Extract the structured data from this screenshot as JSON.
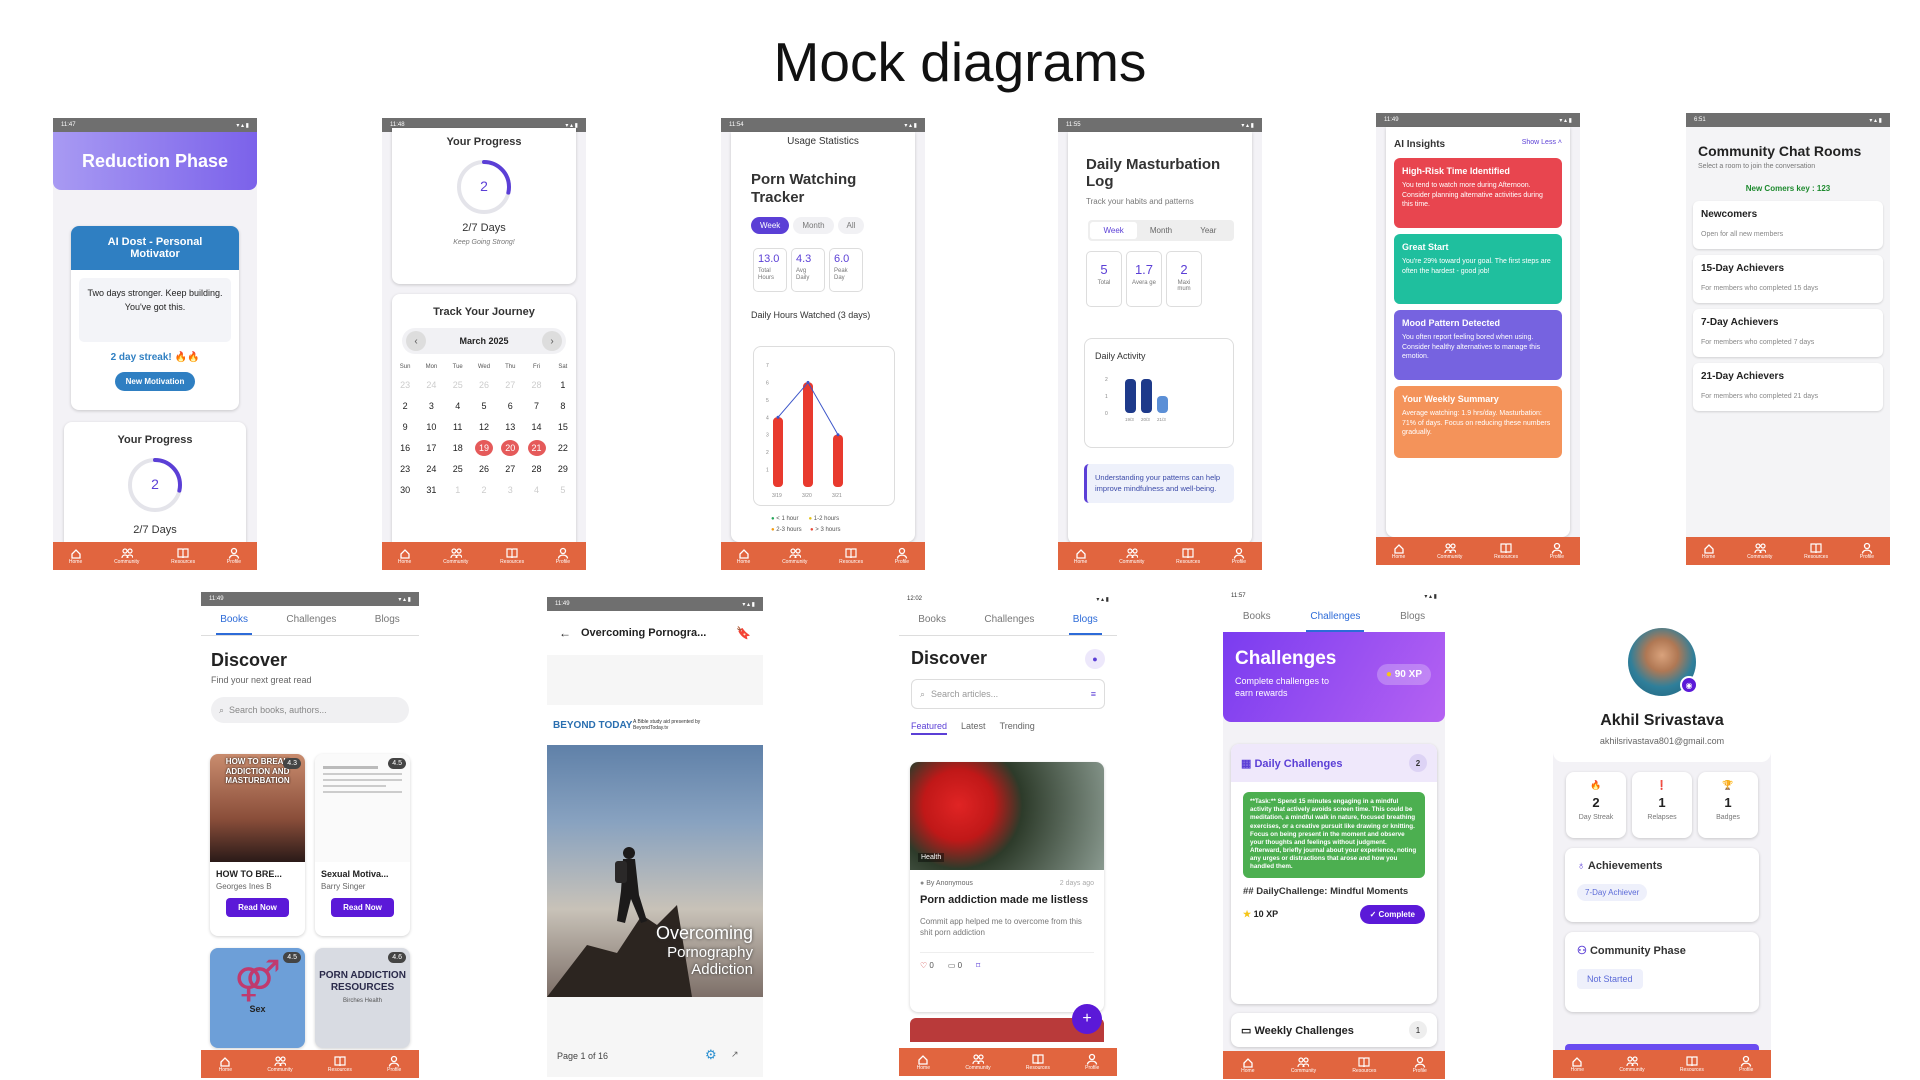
{
  "page_title": "Mock diagrams",
  "nav": {
    "home": "Home",
    "community": "Community",
    "resources": "Resources",
    "profile": "Profile"
  },
  "p1": {
    "time": "11:47",
    "header": "Reduction Phase",
    "motivator_title": "AI Dost - Personal Motivator",
    "message": "Two days stronger.  Keep building.  You've got this.",
    "streak": "2 day streak! 🔥🔥",
    "button": "New Motivation",
    "progress_title": "Your Progress",
    "progress_value": "2",
    "progress_days": "2/7 Days",
    "progress_fraction": 0.2857
  },
  "p2": {
    "time": "11:48",
    "progress_title": "Your Progress",
    "progress_value": "2",
    "progress_days": "2/7 Days",
    "progress_sub": "Keep Going Strong!",
    "progress_fraction": 0.2857,
    "journey_title": "Track Your Journey",
    "month": "March 2025",
    "weekdays": [
      "Sun",
      "Mon",
      "Tue",
      "Wed",
      "Thu",
      "Fri",
      "Sat"
    ],
    "weeks": [
      [
        "23",
        "24",
        "25",
        "26",
        "27",
        "28",
        "1"
      ],
      [
        "2",
        "3",
        "4",
        "5",
        "6",
        "7",
        "8"
      ],
      [
        "9",
        "10",
        "11",
        "12",
        "13",
        "14",
        "15"
      ],
      [
        "16",
        "17",
        "18",
        "19",
        "20",
        "21",
        "22"
      ],
      [
        "23",
        "24",
        "25",
        "26",
        "27",
        "28",
        "29"
      ],
      [
        "30",
        "31",
        "1",
        "2",
        "3",
        "4",
        "5"
      ]
    ]
  },
  "p3": {
    "time": "11:54",
    "header": "Usage Statistics",
    "title": "Porn Watching Tracker",
    "tabs": [
      "Week",
      "Month",
      "All"
    ],
    "stats": [
      {
        "value": "13.0",
        "label": "Total Hours"
      },
      {
        "value": "4.3",
        "label": "Avg Daily"
      },
      {
        "value": "6.0",
        "label": "Peak Day"
      }
    ],
    "chart_title": "Daily Hours Watched (3 days)",
    "legend": [
      "< 1 hour",
      "1-2 hours",
      "2-3 hours",
      "> 3 hours"
    ]
  },
  "p4": {
    "time": "11:55",
    "title": "Daily Masturbation Log",
    "subtitle": "Track your habits and patterns",
    "tabs": [
      "Week",
      "Month",
      "Year"
    ],
    "stats": [
      {
        "value": "5",
        "label": "Total"
      },
      {
        "value": "1.7",
        "label": "Avera ge"
      },
      {
        "value": "2",
        "label": "Maxi mum"
      }
    ],
    "activity_title": "Daily Activity",
    "note": "Understanding your patterns can help improve mindfulness and well-being."
  },
  "p5": {
    "time": "11:49",
    "title": "AI Insights",
    "toggle": "Show Less",
    "cards": [
      {
        "title": "High-Risk Time Identified",
        "text": "You tend to watch more during Afternoon. Consider planning alternative activities during this time.",
        "color": "#e8454f"
      },
      {
        "title": "Great Start",
        "text": "You're 29% toward your goal. The first steps are often the hardest - good job!",
        "color": "#1fbf9e"
      },
      {
        "title": "Mood Pattern Detected",
        "text": "You often report feeling bored when using. Consider healthy alternatives to manage this emotion.",
        "color": "#7663e0"
      },
      {
        "title": "Your Weekly Summary",
        "text": "Average watching: 1.9 hrs/day. Masturbation: 71% of days. Focus on reducing these numbers gradually.",
        "color": "#f4935a"
      }
    ]
  },
  "p6": {
    "time": "6:51",
    "title": "Community Chat Rooms",
    "subtitle": "Select a room to join the conversation",
    "key": "New Comers key : 123",
    "rooms": [
      {
        "name": "Newcomers",
        "desc": "Open for all new members"
      },
      {
        "name": "15-Day Achievers",
        "desc": "For members who completed 15 days"
      },
      {
        "name": "7-Day Achievers",
        "desc": "For members who completed 7 days"
      },
      {
        "name": "21-Day Achievers",
        "desc": "For members who completed 21 days"
      }
    ]
  },
  "p7": {
    "time": "11:49",
    "tabs": [
      "Books",
      "Challenges",
      "Blogs"
    ],
    "title": "Discover",
    "subtitle": "Find your next great read",
    "search_placeholder": "Search books, authors...",
    "books": [
      {
        "title": "HOW TO BRE...",
        "author": "Georges Ines B",
        "rating": "4.3",
        "cover_text": "HOW TO BREAK ADDICTION AND MASTURBATION",
        "button": "Read Now"
      },
      {
        "title": "Sexual Motiva...",
        "author": "Barry Singer",
        "rating": "4.5",
        "button": "Read Now"
      },
      {
        "rating": "4.5",
        "cover_text": "Sex"
      },
      {
        "rating": "4.6",
        "cover_text": "PORN ADDICTION RESOURCES",
        "cover_sub": "Birches Health"
      }
    ]
  },
  "p8": {
    "time": "11:49",
    "title": "Overcoming Pornogra...",
    "brand": "BEYOND TODAY",
    "brand_sub": "A Bible study aid presented by BeyondToday.tv",
    "cover_title": "Overcoming",
    "cover_sub1": "Pornography",
    "cover_sub2": "Addiction",
    "page": "Page 1 of 16"
  },
  "p9": {
    "time": "12:02",
    "tabs": [
      "Books",
      "Challenges",
      "Blogs"
    ],
    "title": "Discover",
    "search_placeholder": "Search articles...",
    "filters": [
      "Featured",
      "Latest",
      "Trending"
    ],
    "tag": "Health",
    "author": "By Anonymous",
    "ago": "2 days ago",
    "post_title": "Porn addiction made me listless",
    "post_text": "Commit app helped me to overcome from this shit porn addiction",
    "likes": "0",
    "comments": "0"
  },
  "p10": {
    "time": "11:57",
    "tabs": [
      "Books",
      "Challenges",
      "Blogs"
    ],
    "title": "Challenges",
    "subtitle": "Complete challenges to earn rewards",
    "xp": "90 XP",
    "daily": "Daily Challenges",
    "daily_count": "2",
    "task": "**Task:** Spend 15 minutes engaging in a mindful activity that actively avoids screen time. This could be meditation, a mindful walk in nature, focused breathing exercises, or a creative pursuit like drawing or knitting. Focus on being present in the moment and observe your thoughts and feelings without judgment. Afterward, briefly journal about your experience, noting any urges or distractions that arose and how you handled them.",
    "challenge_name": "## DailyChallenge:  Mindful Moments",
    "reward": "10 XP",
    "complete": "Complete",
    "weekly": "Weekly Challenges",
    "weekly_count": "1"
  },
  "p11": {
    "name": "Akhil Srivastava",
    "email": "akhilsrivastava801@gmail.com",
    "stats": [
      {
        "value": "2",
        "label": "Day Streak"
      },
      {
        "value": "1",
        "label": "Relapses"
      },
      {
        "value": "1",
        "label": "Badges"
      }
    ],
    "achievements": "Achievements",
    "badge": "7-Day Achiever",
    "phase": "Community Phase",
    "phase_status": "Not Started"
  },
  "chart_data": [
    {
      "type": "line",
      "title": "Daily Hours Watched (3 days)",
      "categories": [
        "3/19",
        "3/20",
        "3/21"
      ],
      "values": [
        4,
        6,
        3
      ],
      "ylim": [
        0,
        7
      ]
    },
    {
      "type": "bar",
      "title": "Daily Activity",
      "categories": [
        "19/3",
        "20/3",
        "21/3"
      ],
      "values": [
        2,
        2,
        1
      ],
      "ylim": [
        0,
        2
      ]
    }
  ],
  "colors": {
    "nav": "#e1653f",
    "accent": "#5b3fd6",
    "header_grad_start": "#9b8cf0",
    "header_grad_end": "#6f57e8"
  }
}
